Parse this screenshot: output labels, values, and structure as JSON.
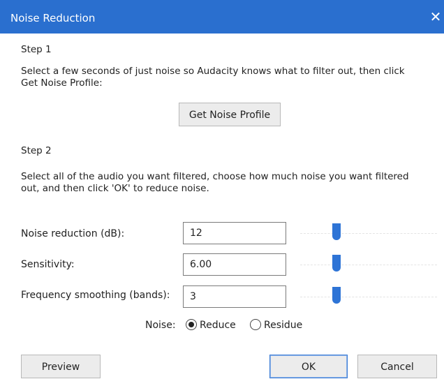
{
  "dialog": {
    "title": "Noise Reduction",
    "close_glyph": "✕",
    "step1": {
      "heading": "Step 1",
      "instructions": "Select a few seconds of just noise so Audacity knows what to filter out, then click Get Noise Profile:",
      "button": "Get Noise Profile"
    },
    "step2": {
      "heading": "Step 2",
      "instructions": "Select all of the audio you want filtered, choose how much noise you want filtered out, and then click 'OK' to reduce noise."
    },
    "params": {
      "noise_reduction": {
        "label": "Noise reduction (dB):",
        "value": "12"
      },
      "sensitivity": {
        "label": "Sensitivity:",
        "value": "6.00"
      },
      "frequency_smoothing": {
        "label": "Frequency smoothing (bands):",
        "value": "3"
      }
    },
    "noise": {
      "label": "Noise:",
      "options": [
        "Reduce",
        "Residue"
      ],
      "selected": "Reduce"
    },
    "buttons": {
      "preview": "Preview",
      "ok": "OK",
      "cancel": "Cancel"
    },
    "colors": {
      "titlebar": "#2a6fcf",
      "slider_thumb": "#2e74d6"
    }
  }
}
